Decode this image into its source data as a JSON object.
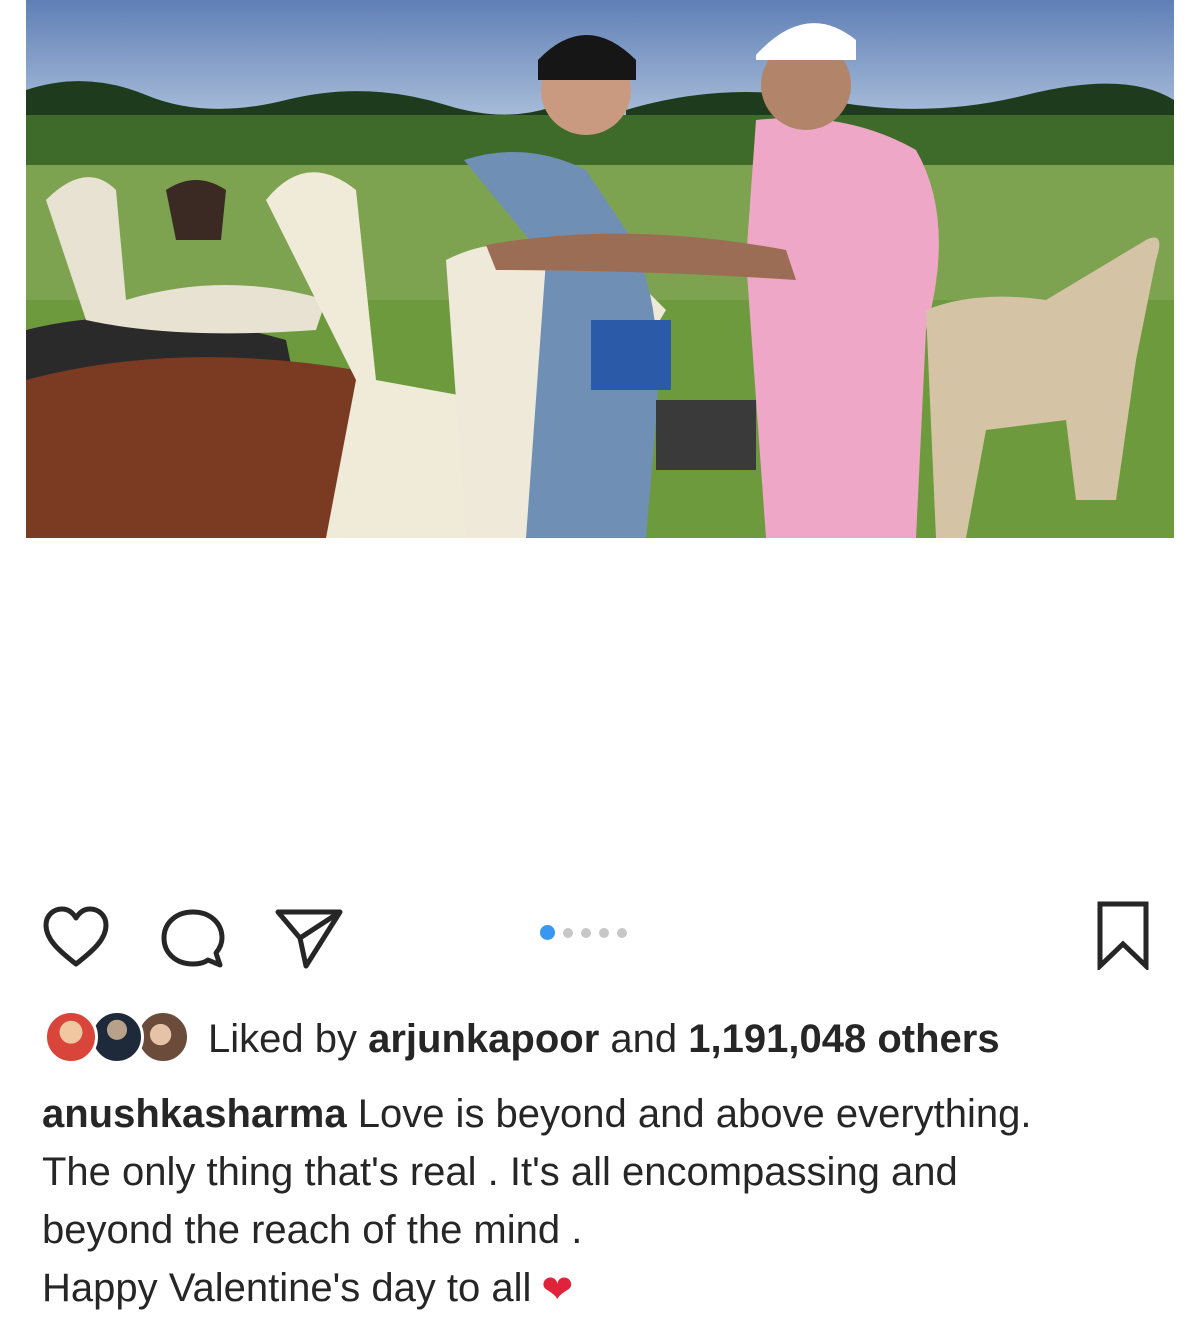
{
  "post": {
    "image_description_icon": "photo",
    "carousel": {
      "count": 5,
      "active_index": 0
    }
  },
  "actions": {
    "like_icon": "heart-icon",
    "comment_icon": "comment-icon",
    "share_icon": "paper-plane-icon",
    "save_icon": "bookmark-icon"
  },
  "likes": {
    "prefix": "Liked by",
    "user": "arjunkapoor",
    "connector": "and",
    "count": "1,191,048 others"
  },
  "caption": {
    "username": "anushkasharma",
    "line1": " Love is beyond and above everything.",
    "line2": "The only thing that's real . It's all encompassing and",
    "line3": "beyond the reach of the mind .",
    "line4": "Happy Valentine's day to all",
    "emoji": "❤"
  },
  "colors": {
    "accent": "#3897f0",
    "text": "#262626",
    "heart": "#e0223a"
  }
}
